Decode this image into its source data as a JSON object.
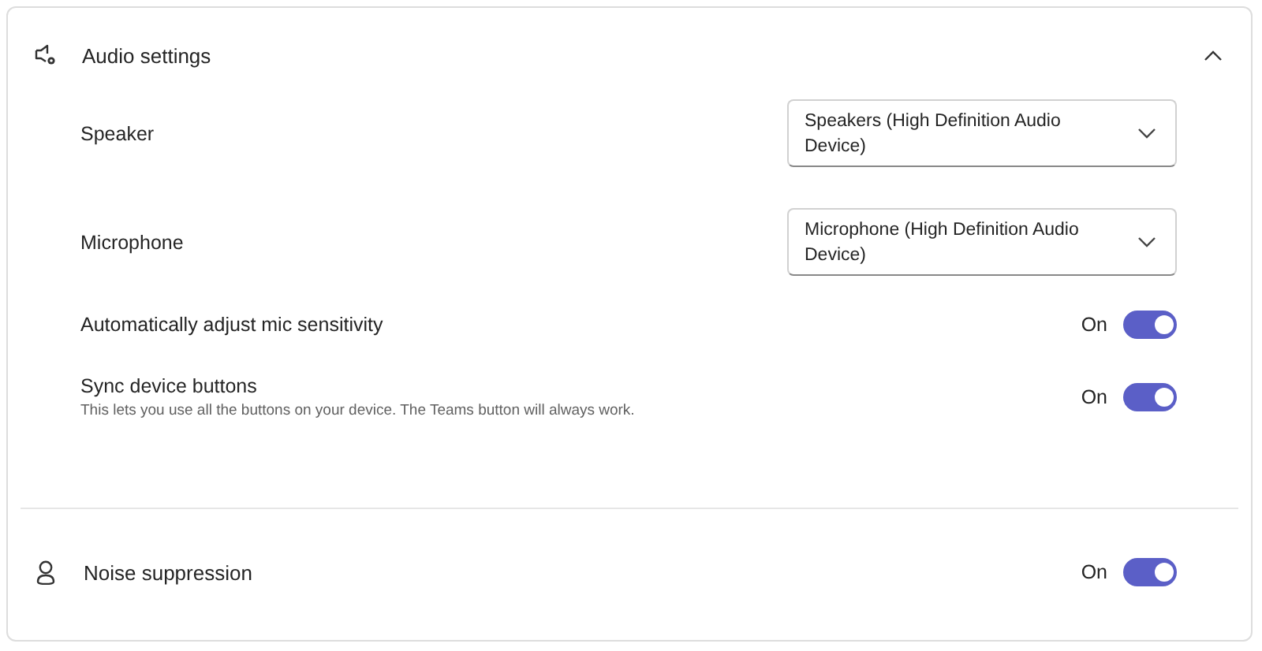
{
  "section": {
    "title": "Audio settings",
    "expanded": true,
    "rows": [
      {
        "kind": "dropdown",
        "label": "Speaker",
        "value": "Speakers (High Definition Audio Device)"
      },
      {
        "kind": "dropdown",
        "label": "Microphone",
        "value": "Microphone (High Definition Audio Device)"
      },
      {
        "kind": "toggle",
        "label": "Automatically adjust mic sensitivity",
        "state_text": "On",
        "on": true
      },
      {
        "kind": "toggle",
        "label": "Sync device buttons",
        "description": "This lets you use all the buttons on your device. The Teams button will always work.",
        "state_text": "On",
        "on": true
      }
    ]
  },
  "noise_suppression": {
    "label": "Noise suppression",
    "state_text": "On",
    "on": true
  }
}
